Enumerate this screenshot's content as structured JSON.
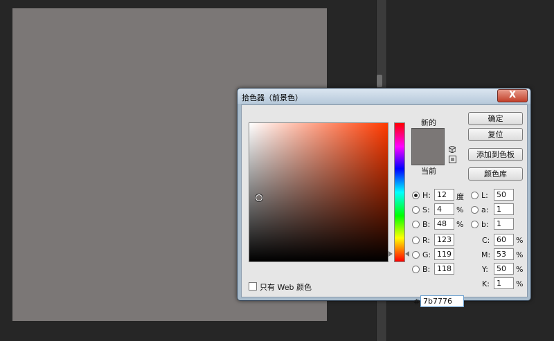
{
  "dialog": {
    "title": "拾色器（前景色）",
    "close_label": "X",
    "new_label": "新的",
    "current_label": "当前",
    "buttons": {
      "ok": "确定",
      "reset": "复位",
      "add_to_swatches": "添加到色板",
      "color_libraries": "颜色库"
    },
    "hsb": {
      "h_label": "H:",
      "h_value": "12",
      "h_unit": "度",
      "s_label": "S:",
      "s_value": "4",
      "s_unit": "%",
      "b_label": "B:",
      "b_value": "48",
      "b_unit": "%"
    },
    "rgb": {
      "r_label": "R:",
      "r_value": "123",
      "g_label": "G:",
      "g_value": "119",
      "b_label": "B:",
      "b_value": "118"
    },
    "lab": {
      "l_label": "L:",
      "l_value": "50",
      "a_label": "a:",
      "a_value": "1",
      "b_label": "b:",
      "b_value": "1"
    },
    "cmyk": {
      "c_label": "C:",
      "c_value": "60",
      "m_label": "M:",
      "m_value": "53",
      "y_label": "Y:",
      "y_value": "50",
      "k_label": "K:",
      "k_value": "1",
      "unit": "%"
    },
    "web_only_label": "只有 Web 颜色",
    "hash": "#",
    "hex_value": "7b7776",
    "selected_radio": "H",
    "colors": {
      "current_color": "#7b7776",
      "new_color": "#7b7776",
      "hue_color": "#ff3a00"
    }
  }
}
